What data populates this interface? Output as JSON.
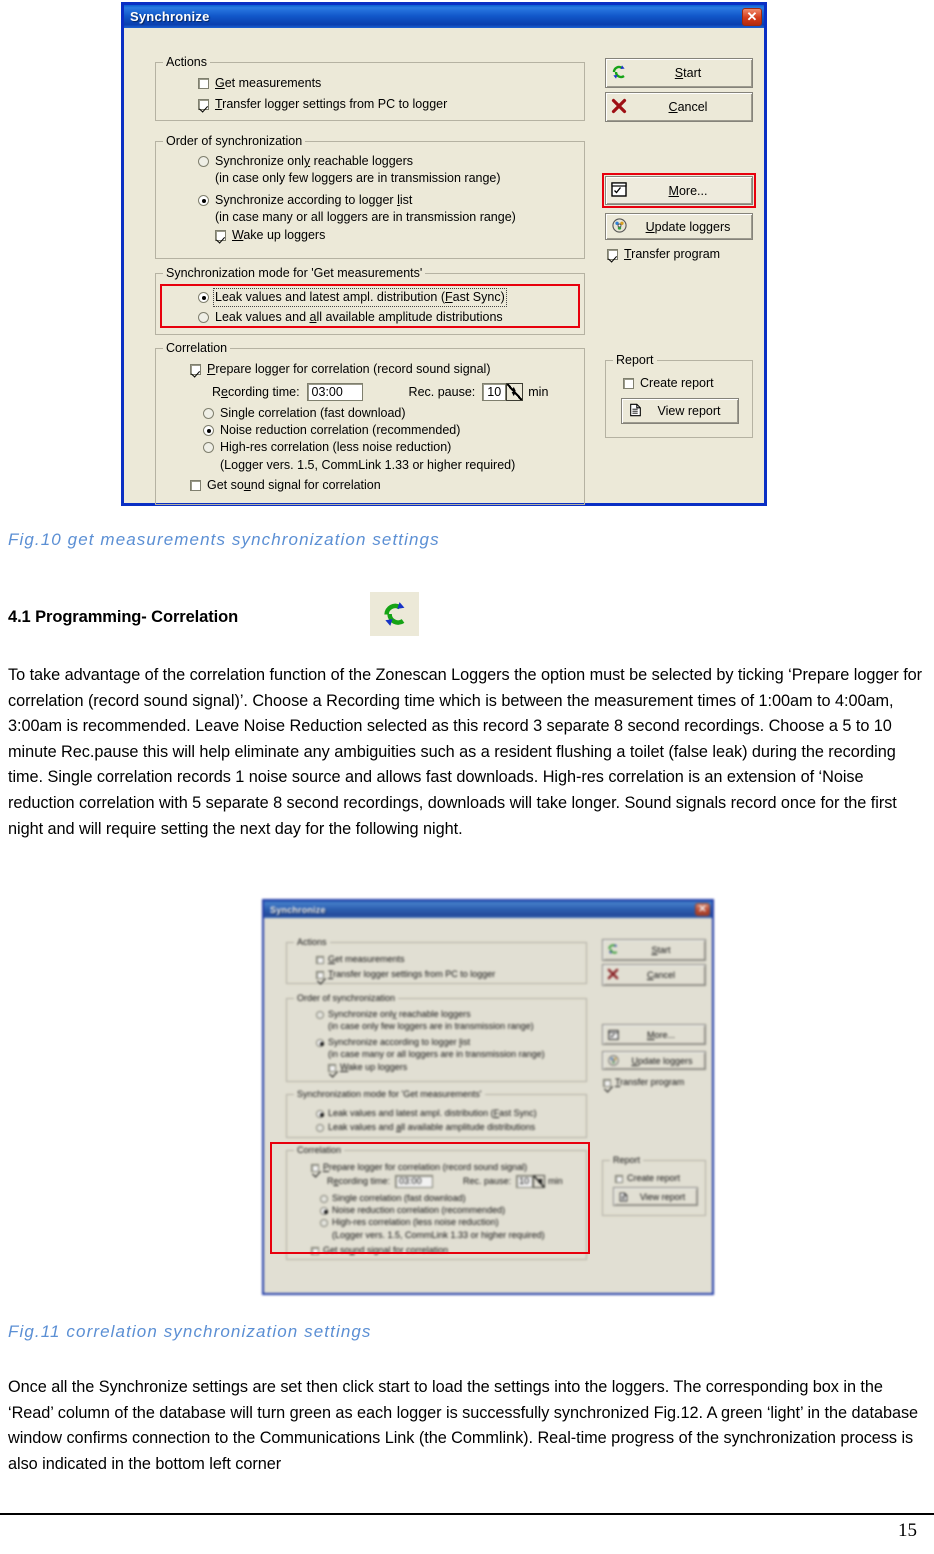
{
  "document": {
    "page_number": "15",
    "heading": "4.1 Programming- Correlation",
    "caption_fig10": "Fig.10 get measurements synchronization settings",
    "caption_fig11": "Fig.11 correlation synchronization settings",
    "paragraph_1": "To take advantage of the correlation function of the Zonescan Loggers the option must be selected by ticking ‘Prepare logger for correlation (record sound signal)’. Choose a Recording time which is between the measurement times of 1:00am to 4:00am, 3:00am is recommended. Leave Noise Reduction selected as this record 3 separate 8 second recordings. Choose a 5 to 10 minute Rec.pause this will help eliminate any ambiguities such as a resident flushing a toilet (false leak) during the recording time. Single correlation records 1 noise source and allows fast downloads. High-res correlation is an extension of ‘Noise reduction correlation with 5 separate 8 second recordings, downloads will take longer. Sound signals record once for the first night and will require setting the next day for the following night.",
    "paragraph_2": "Once all the Synchronize settings are set then click start to load the settings into the loggers. The corresponding box in the ‘Read’ column of the database will turn green as each logger is successfully synchronized Fig.12. A green ‘light’ in the database window confirms connection to the Communications Link (the Commlink). Real-time progress of the synchronization process is also indicated in the bottom left corner",
    "heading_icon": "refresh-sync-icon"
  },
  "colors": {
    "caption_blue": "#5b8fd4",
    "titlebar_blue": "#1157c9",
    "dialog_face": "#ece9d8",
    "highlight_red": "#e8000d",
    "dialog_border": "#0a2fc4"
  },
  "dialog": {
    "title": "Synchronize",
    "close_icon": "close-icon",
    "actions": {
      "legend": "Actions",
      "items": [
        {
          "label": "Get measurements",
          "accel": "G",
          "checked": false
        },
        {
          "label": "Transfer logger settings from PC to logger",
          "accel": "T",
          "checked": true
        }
      ]
    },
    "order": {
      "legend": "Order of synchronization",
      "options": [
        {
          "label": "Synchronize only reachable loggers",
          "accel": "y",
          "hint": "(in case only few loggers are in transmission range)",
          "selected": false
        },
        {
          "label": "Synchronize according to logger list",
          "accel": "l",
          "hint": "(in case many or all loggers are in transmission range)",
          "selected": true
        }
      ],
      "wake_up": {
        "label": "Wake up loggers",
        "checked": true
      }
    },
    "sync_mode": {
      "legend": "Synchronization mode for 'Get measurements'",
      "options": [
        {
          "label": "Leak values and latest ampl. distribution (Fast Sync)",
          "selected": true
        },
        {
          "label": "Leak values and all available amplitude distributions",
          "selected": false
        }
      ],
      "highlighted": true
    },
    "correlation": {
      "legend": "Correlation",
      "prepare": {
        "label": "Prepare logger for correlation (record sound signal)",
        "checked": true
      },
      "recording_time_label": "Recording time:",
      "recording_time_value": "03:00",
      "rec_pause_label": "Rec. pause:",
      "rec_pause_value": "10",
      "rec_pause_unit": "min",
      "options": [
        {
          "label": "Single correlation (fast download)",
          "selected": false
        },
        {
          "label": "Noise reduction correlation (recommended)",
          "selected": true
        },
        {
          "label": "High-res correlation (less noise reduction)",
          "selected": false
        }
      ],
      "note": "(Logger vers. 1.5, CommLink 1.33 or higher required)",
      "get_sound": {
        "label": "Get sound signal for correlation",
        "checked": false
      }
    },
    "buttons": [
      {
        "name": "start",
        "label": "Start",
        "icon": "refresh-sync-icon"
      },
      {
        "name": "cancel",
        "label": "Cancel",
        "icon": "x-mark-icon"
      },
      {
        "name": "more",
        "label": "More...",
        "icon": "window-checklist-icon",
        "highlighted": true
      },
      {
        "name": "update-loggers",
        "label": "Update loggers",
        "icon": "cd-disc-icon"
      }
    ],
    "transfer_program": {
      "label": "Transfer program",
      "checked": true
    },
    "report": {
      "legend": "Report",
      "create": {
        "label": "Create report",
        "checked": false
      },
      "view_button": {
        "label": "View report",
        "icon": "document-icon"
      }
    }
  }
}
